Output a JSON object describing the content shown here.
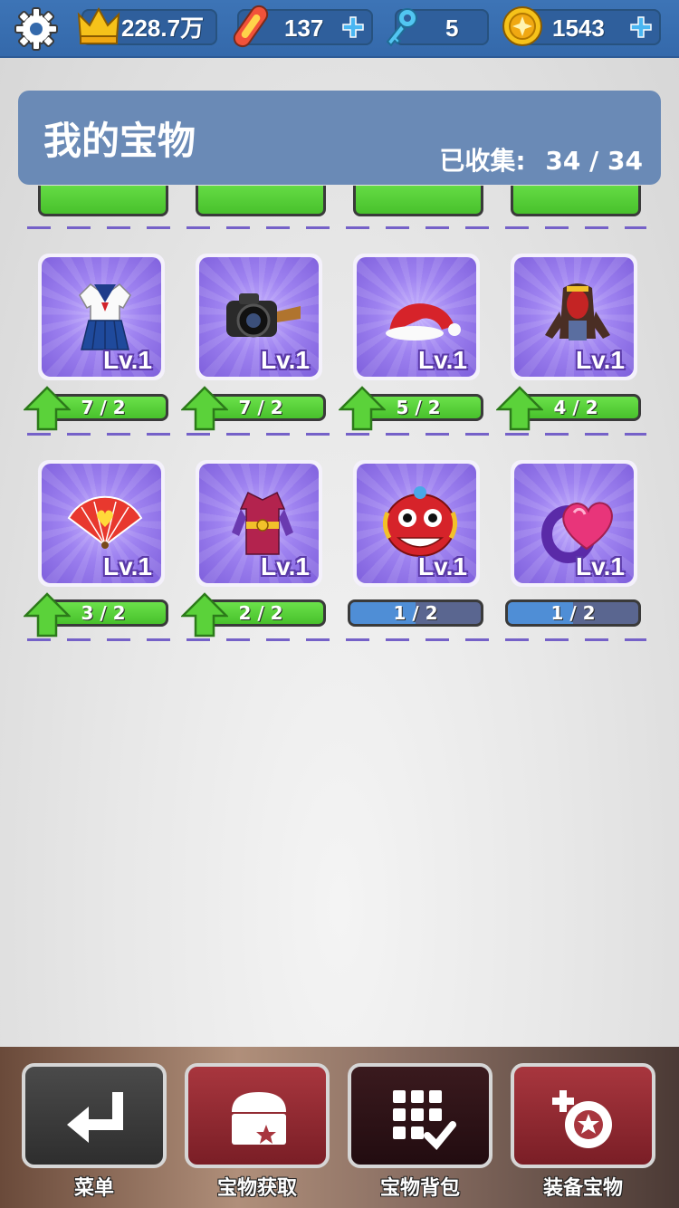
{
  "topbar": {
    "crown": "228.7万",
    "board": "137",
    "keys": "5",
    "coins": "1543",
    "icons": [
      "gear-icon",
      "crown-icon",
      "hoverboard-icon",
      "key-icon",
      "coin-icon",
      "plus-icon"
    ]
  },
  "header": {
    "title": "我的宝物",
    "collected_label": "已收集:",
    "collected": "34 / 34"
  },
  "items": [
    {
      "name": "sailor-uniform",
      "level": "Lv.1",
      "progress": "7 / 2",
      "ready": true
    },
    {
      "name": "camera",
      "level": "Lv.1",
      "progress": "7 / 2",
      "ready": true
    },
    {
      "name": "santa-hat",
      "level": "Lv.1",
      "progress": "5 / 2",
      "ready": true
    },
    {
      "name": "hooded-jacket",
      "level": "Lv.1",
      "progress": "4 / 2",
      "ready": true
    },
    {
      "name": "folding-fan",
      "level": "Lv.1",
      "progress": "3 / 2",
      "ready": true
    },
    {
      "name": "armor-coat",
      "level": "Lv.1",
      "progress": "2 / 2",
      "ready": true
    },
    {
      "name": "lion-dance-head",
      "level": "Lv.1",
      "progress": "1 / 2",
      "ready": false,
      "fill": 0.5
    },
    {
      "name": "heart-gem-ring",
      "level": "Lv.1",
      "progress": "1 / 2",
      "ready": false,
      "fill": 0.5
    }
  ],
  "nav": [
    {
      "label": "菜单",
      "icon": "return-arrow-icon"
    },
    {
      "label": "宝物获取",
      "icon": "treasure-chest-icon"
    },
    {
      "label": "宝物背包",
      "icon": "grid-check-icon"
    },
    {
      "label": "装备宝物",
      "icon": "equip-badge-icon"
    }
  ],
  "colors": {
    "green": "#48c12c",
    "blue": "#4f8ed6",
    "card": "#9e82f0",
    "header": "#6a8ab6"
  }
}
